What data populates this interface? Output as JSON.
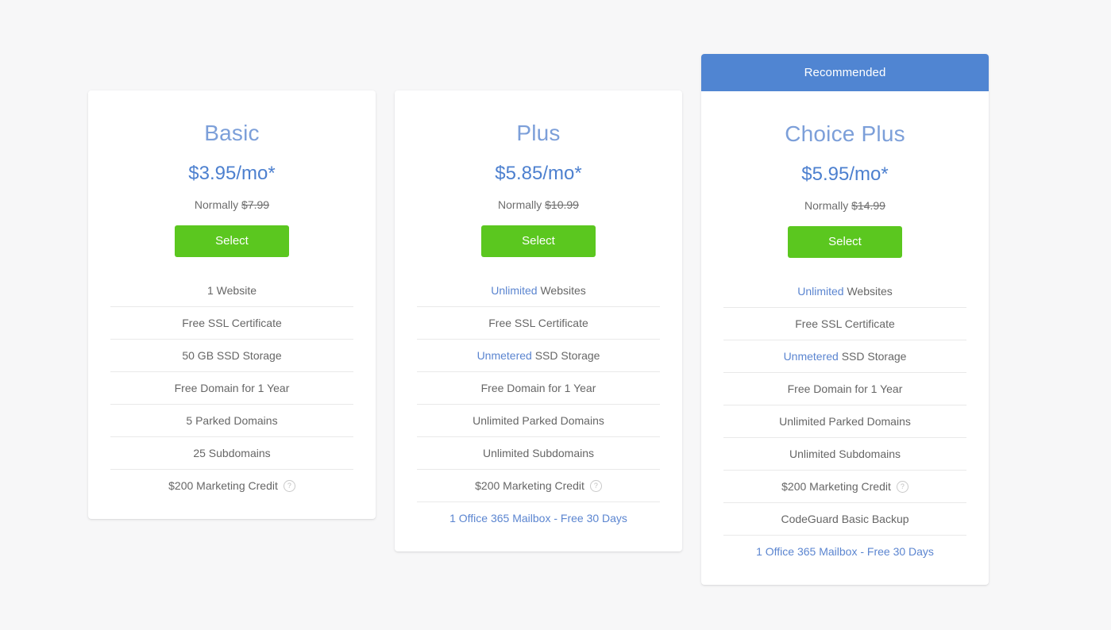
{
  "page": {
    "background_color": "#f7f7f8",
    "accent_blue": "#5b85d0",
    "ribbon_blue": "#5085d2",
    "button_green": "#5bc71f",
    "title_blue": "#7c9fd9",
    "price_blue": "#4d80cf"
  },
  "plans": [
    {
      "id": "basic",
      "name": "Basic",
      "price": "$3.95/mo*",
      "normally_label": "Normally",
      "normally_price": "$7.99",
      "select_label": "Select",
      "ribbon": null,
      "features": [
        {
          "prefix": "",
          "text": "1 Website",
          "link": false,
          "help": false
        },
        {
          "prefix": "",
          "text": "Free SSL Certificate",
          "link": false,
          "help": false
        },
        {
          "prefix": "",
          "text": "50 GB SSD Storage",
          "link": false,
          "help": false
        },
        {
          "prefix": "",
          "text": "Free Domain for 1 Year",
          "link": false,
          "help": false
        },
        {
          "prefix": "",
          "text": "5 Parked Domains",
          "link": false,
          "help": false
        },
        {
          "prefix": "",
          "text": "25 Subdomains",
          "link": false,
          "help": false
        },
        {
          "prefix": "",
          "text": "$200 Marketing Credit",
          "link": false,
          "help": true
        }
      ]
    },
    {
      "id": "plus",
      "name": "Plus",
      "price": "$5.85/mo*",
      "normally_label": "Normally",
      "normally_price": "$10.99",
      "select_label": "Select",
      "ribbon": null,
      "features": [
        {
          "prefix": "Unlimited",
          "text": "Websites",
          "link": false,
          "help": false
        },
        {
          "prefix": "",
          "text": "Free SSL Certificate",
          "link": false,
          "help": false
        },
        {
          "prefix": "Unmetered",
          "text": "SSD Storage",
          "link": false,
          "help": false
        },
        {
          "prefix": "",
          "text": "Free Domain for 1 Year",
          "link": false,
          "help": false
        },
        {
          "prefix": "",
          "text": "Unlimited Parked Domains",
          "link": false,
          "help": false
        },
        {
          "prefix": "",
          "text": "Unlimited Subdomains",
          "link": false,
          "help": false
        },
        {
          "prefix": "",
          "text": "$200 Marketing Credit",
          "link": false,
          "help": true
        },
        {
          "prefix": "",
          "text": "1 Office 365 Mailbox - Free 30 Days",
          "link": true,
          "help": false
        }
      ]
    },
    {
      "id": "choiceplus",
      "name": "Choice Plus",
      "price": "$5.95/mo*",
      "normally_label": "Normally",
      "normally_price": "$14.99",
      "select_label": "Select",
      "ribbon": "Recommended",
      "features": [
        {
          "prefix": "Unlimited",
          "text": "Websites",
          "link": false,
          "help": false
        },
        {
          "prefix": "",
          "text": "Free SSL Certificate",
          "link": false,
          "help": false
        },
        {
          "prefix": "Unmetered",
          "text": "SSD Storage",
          "link": false,
          "help": false
        },
        {
          "prefix": "",
          "text": "Free Domain for 1 Year",
          "link": false,
          "help": false
        },
        {
          "prefix": "",
          "text": "Unlimited Parked Domains",
          "link": false,
          "help": false
        },
        {
          "prefix": "",
          "text": "Unlimited Subdomains",
          "link": false,
          "help": false
        },
        {
          "prefix": "",
          "text": "$200 Marketing Credit",
          "link": false,
          "help": true
        },
        {
          "prefix": "",
          "text": "CodeGuard Basic Backup",
          "link": false,
          "help": false
        },
        {
          "prefix": "",
          "text": "1 Office 365 Mailbox - Free 30 Days",
          "link": true,
          "help": false
        }
      ]
    }
  ],
  "icons": {
    "help": "?"
  }
}
